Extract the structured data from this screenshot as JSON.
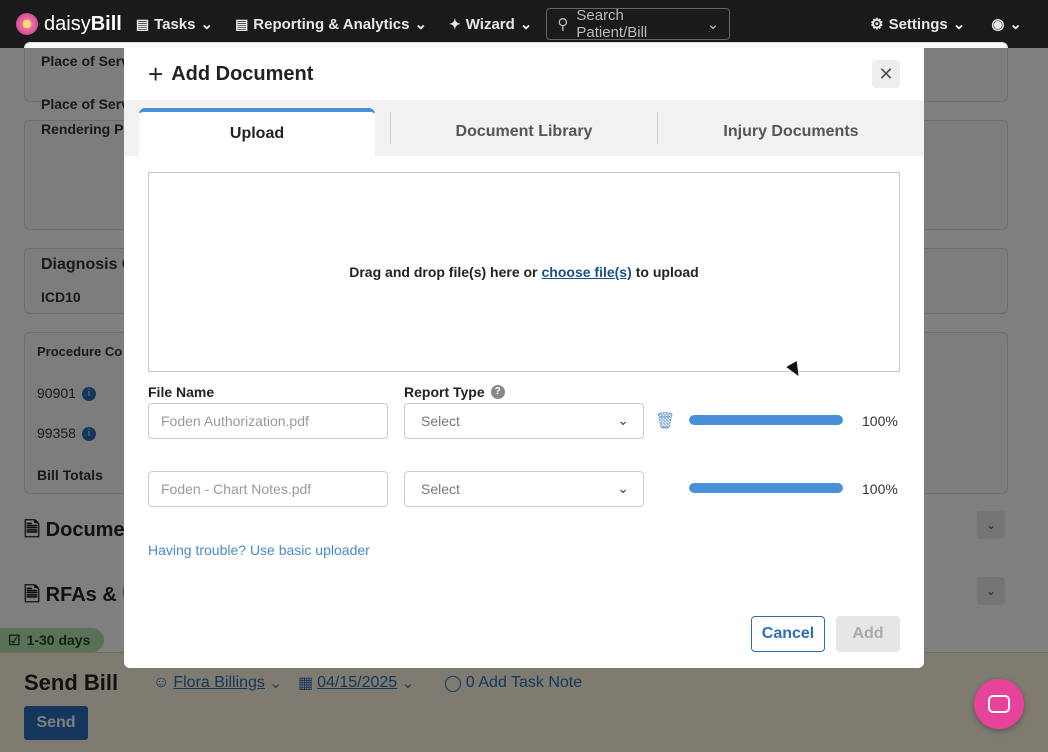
{
  "navbar": {
    "brand_prefix": "daisy",
    "brand_suffix": "Bill",
    "tasks": "Tasks",
    "reporting": "Reporting & Analytics",
    "wizard": "Wizard",
    "search_placeholder": "Search Patient/Bill",
    "settings": "Settings"
  },
  "background": {
    "place_of_service_1": "Place of Serv",
    "place_of_service_2": "Place of Serv",
    "rendering_provider": "Rendering Pr",
    "diagnosis_title": "Diagnosis C",
    "icd10": "ICD10",
    "procedure_codes": "Procedure Co",
    "code_1": "90901",
    "code_2": "99358",
    "bill_totals": "Bill Totals",
    "documents_title": "Docume",
    "rfas_title": "RFAs & U",
    "days_tag": "1-30 days",
    "send_bill_title": "Send Bill",
    "send_button": "Send",
    "assignee": "Flora Billings",
    "date": "04/15/2025",
    "task_note": "0 Add Task Note"
  },
  "modal": {
    "title": "Add Document",
    "tabs": [
      {
        "label": "Upload",
        "active": true
      },
      {
        "label": "Document Library",
        "active": false
      },
      {
        "label": "Injury Documents",
        "active": false
      }
    ],
    "dropzone": {
      "prefix": "Drag and drop file(s) here or",
      "link": "choose file(s)",
      "suffix": "to upload"
    },
    "file_name_label": "File Name",
    "report_type_label": "Report Type",
    "files": [
      {
        "placeholder": "Foden Authorization.pdf",
        "report_type": "Select",
        "progress": 100,
        "progress_label": "100%"
      },
      {
        "placeholder": "Foden - Chart Notes.pdf",
        "report_type": "Select",
        "progress": 100,
        "progress_label": "100%"
      }
    ],
    "trouble_link": "Having trouble? Use basic uploader",
    "cancel_button": "Cancel",
    "add_button": "Add"
  },
  "colors": {
    "accent": "#2a6ebb",
    "progress": "#4a90d9",
    "chat": "#e8439b"
  }
}
